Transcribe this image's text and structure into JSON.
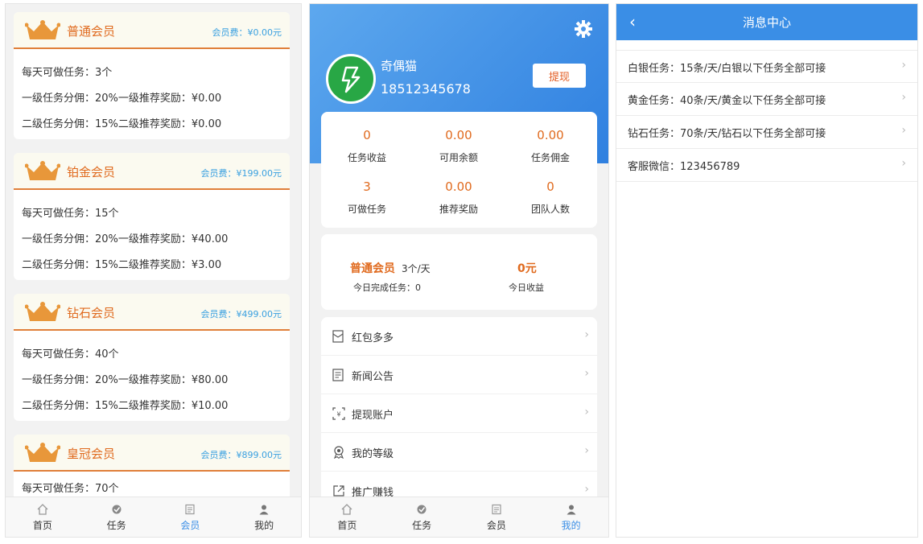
{
  "membership": {
    "tiers": [
      {
        "name": "普通会员",
        "fee": "会员费：¥0.00元",
        "daily": "每天可做任务：3个",
        "lvl1": "一级任务分佣：20%一级推荐奖励：¥0.00",
        "lvl2": "二级任务分佣：15%二级推荐奖励：¥0.00"
      },
      {
        "name": "铂金会员",
        "fee": "会员费：¥199.00元",
        "daily": "每天可做任务：15个",
        "lvl1": "一级任务分佣：20%一级推荐奖励：¥40.00",
        "lvl2": "二级任务分佣：15%二级推荐奖励：¥3.00"
      },
      {
        "name": "钻石会员",
        "fee": "会员费：¥499.00元",
        "daily": "每天可做任务：40个",
        "lvl1": "一级任务分佣：20%一级推荐奖励：¥80.00",
        "lvl2": "二级任务分佣：15%二级推荐奖励：¥10.00"
      },
      {
        "name": "皇冠会员",
        "fee": "会员费：¥899.00元",
        "daily": "每天可做任务：70个"
      }
    ],
    "tabbar": [
      "首页",
      "任务",
      "会员",
      "我的"
    ],
    "active_tab": "会员"
  },
  "profile": {
    "username": "奇偶猫",
    "phone": "18512345678",
    "withdraw_label": "提现",
    "stats": [
      {
        "value": "0",
        "label": "任务收益"
      },
      {
        "value": "0.00",
        "label": "可用余额"
      },
      {
        "value": "0.00",
        "label": "任务佣金"
      },
      {
        "value": "3",
        "label": "可做任务"
      },
      {
        "value": "0.00",
        "label": "推荐奖励"
      },
      {
        "value": "0",
        "label": "团队人数"
      }
    ],
    "today": {
      "level": "普通会员",
      "quota": "3个/天",
      "completed": "今日完成任务：0",
      "income_value": "0元",
      "income_label": "今日收益"
    },
    "menu": [
      {
        "label": "红包多多",
        "icon": "red-envelope-icon"
      },
      {
        "label": "新闻公告",
        "icon": "news-icon"
      },
      {
        "label": "提现账户",
        "icon": "withdraw-account-icon"
      },
      {
        "label": "我的等级",
        "icon": "level-badge-icon"
      },
      {
        "label": "推广赚钱",
        "icon": "share-icon"
      }
    ],
    "tabbar": [
      "首页",
      "任务",
      "会员",
      "我的"
    ],
    "active_tab": "我的"
  },
  "messages": {
    "title": "消息中心",
    "items": [
      "白银任务：15条/天/白银以下任务全部可接",
      "黄金任务：40条/天/黄金以下任务全部可接",
      "钻石任务：70条/天/钻石以下任务全部可接",
      "客服微信：123456789"
    ]
  },
  "colors": {
    "accent": "#3a8ee6",
    "orange": "#e06a1e",
    "crown": "#e8973a"
  }
}
